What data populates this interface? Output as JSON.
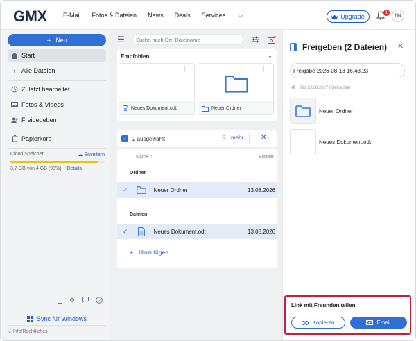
{
  "header": {
    "logo": "GMX",
    "nav": [
      "E-Mail",
      "Fotos & Dateien",
      "News",
      "Deals",
      "Services"
    ],
    "upgrade_label": "Upgrade",
    "notification_count": "1",
    "avatar_initials": "NN"
  },
  "sidebar": {
    "new_label": "Neu",
    "items": [
      {
        "label": "Start",
        "icon": "home-icon"
      },
      {
        "label": "Alle Dateien",
        "icon": "chevron-right-icon"
      },
      {
        "label": "Zuletzt bearbeitet",
        "icon": "clock-icon"
      },
      {
        "label": "Fotos & Videos",
        "icon": "image-icon"
      },
      {
        "label": "Freigegeben",
        "icon": "people-icon"
      },
      {
        "label": "Papierkorb",
        "icon": "trash-icon"
      }
    ],
    "cloud": {
      "title": "Cloud Speicher",
      "expand_label": "Erweitern",
      "usage_text": "3,7 GB von 4 GB (93%)",
      "details_label": "Details",
      "percent": 93
    },
    "sync_label": "Sync für Windows",
    "info_label": "Info/Rechtliches"
  },
  "middle": {
    "search_placeholder": "Suche nach Ort, Dateiname",
    "recommended_title": "Empfohlen",
    "recommended": [
      {
        "name": "Neues Dokument.odt",
        "icon": "document-icon"
      },
      {
        "name": "Neuer Ordner",
        "icon": "folder-icon"
      }
    ],
    "selection": {
      "count_label": "2 ausgewählt",
      "more_label": "mehr"
    },
    "list": {
      "col_name": "Name",
      "col_created": "Erstellt",
      "group_folders": "Ordner",
      "group_files": "Dateien",
      "rows": [
        {
          "name": "Neuer Ordner",
          "date": "13.08.2026",
          "icon": "folder-icon"
        },
        {
          "name": "Neues Dokument.odt",
          "date": "13.08.2026",
          "icon": "document-icon"
        }
      ],
      "add_label": "Hinzufügen"
    }
  },
  "panel": {
    "title": "Freigeben (2 Dateien)",
    "share_name": "Freigabe 2026-08-13 16.43.23",
    "info_text": "Bis 13.08.2027 | Betrachter",
    "items": [
      {
        "name": "Neuer Ordner",
        "icon": "folder-icon"
      },
      {
        "name": "Neues Dokument.odt",
        "icon": "document-icon"
      }
    ],
    "share_box": {
      "title": "Link mit Freunden teilen",
      "copy_label": "Kopieren",
      "email_label": "Email"
    }
  },
  "colors": {
    "accent": "#2f6fd6",
    "highlight_border": "#c71f3a",
    "storage_bar": "#f2c100"
  }
}
